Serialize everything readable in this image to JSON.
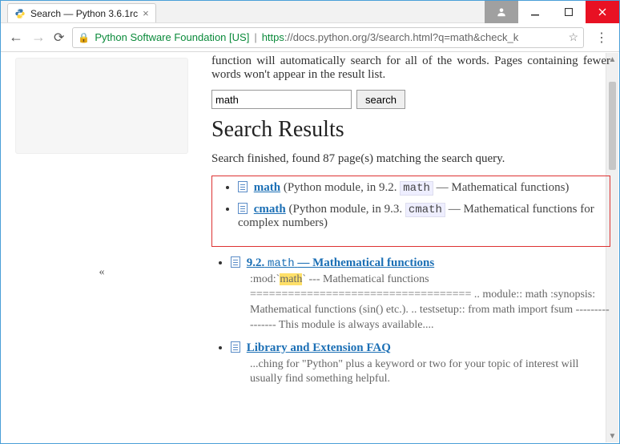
{
  "window": {
    "tab_title": "Search — Python 3.6.1rc"
  },
  "toolbar": {
    "org_label": "Python Software Foundation [US]",
    "url_scheme": "https",
    "url_rest": "://docs.python.org/3/search.html?q=math&check_k"
  },
  "page": {
    "truncated_line": "function  will  automatically  search  for  all  of  the  words.  Pages containing fewer words won't appear in the result list.",
    "search_value": "math",
    "search_button": "search",
    "heading": "Search Results",
    "status": "Search finished, found 87 page(s) matching the search query.",
    "collapse_glyph": "«"
  },
  "results": {
    "boxed": [
      {
        "title": "math",
        "meta_prefix": "(Python module, in 9.2.",
        "code": "math",
        "meta_suffix": "— Mathematical functions)"
      },
      {
        "title": "cmath",
        "meta_prefix": "(Python module, in 9.3.",
        "code": "cmath",
        "meta_suffix": "— Mathematical functions for complex numbers)"
      }
    ],
    "section": {
      "number": "9.2.",
      "code": "math",
      "title_rest": "— Mathematical functions",
      "snippet_pre": ":mod:`",
      "snippet_hl": "math",
      "snippet_post": "` --- Mathematical functions =================================== .. module:: math :synopsis: Mathematical functions (sin() etc.). .. testsetup:: from math import fsum ---------------- This module is always available...."
    },
    "faq": {
      "title": "Library and Extension FAQ",
      "snippet": "...ching for \"Python\" plus a keyword or two for your topic of interest will usually find something helpful."
    }
  }
}
